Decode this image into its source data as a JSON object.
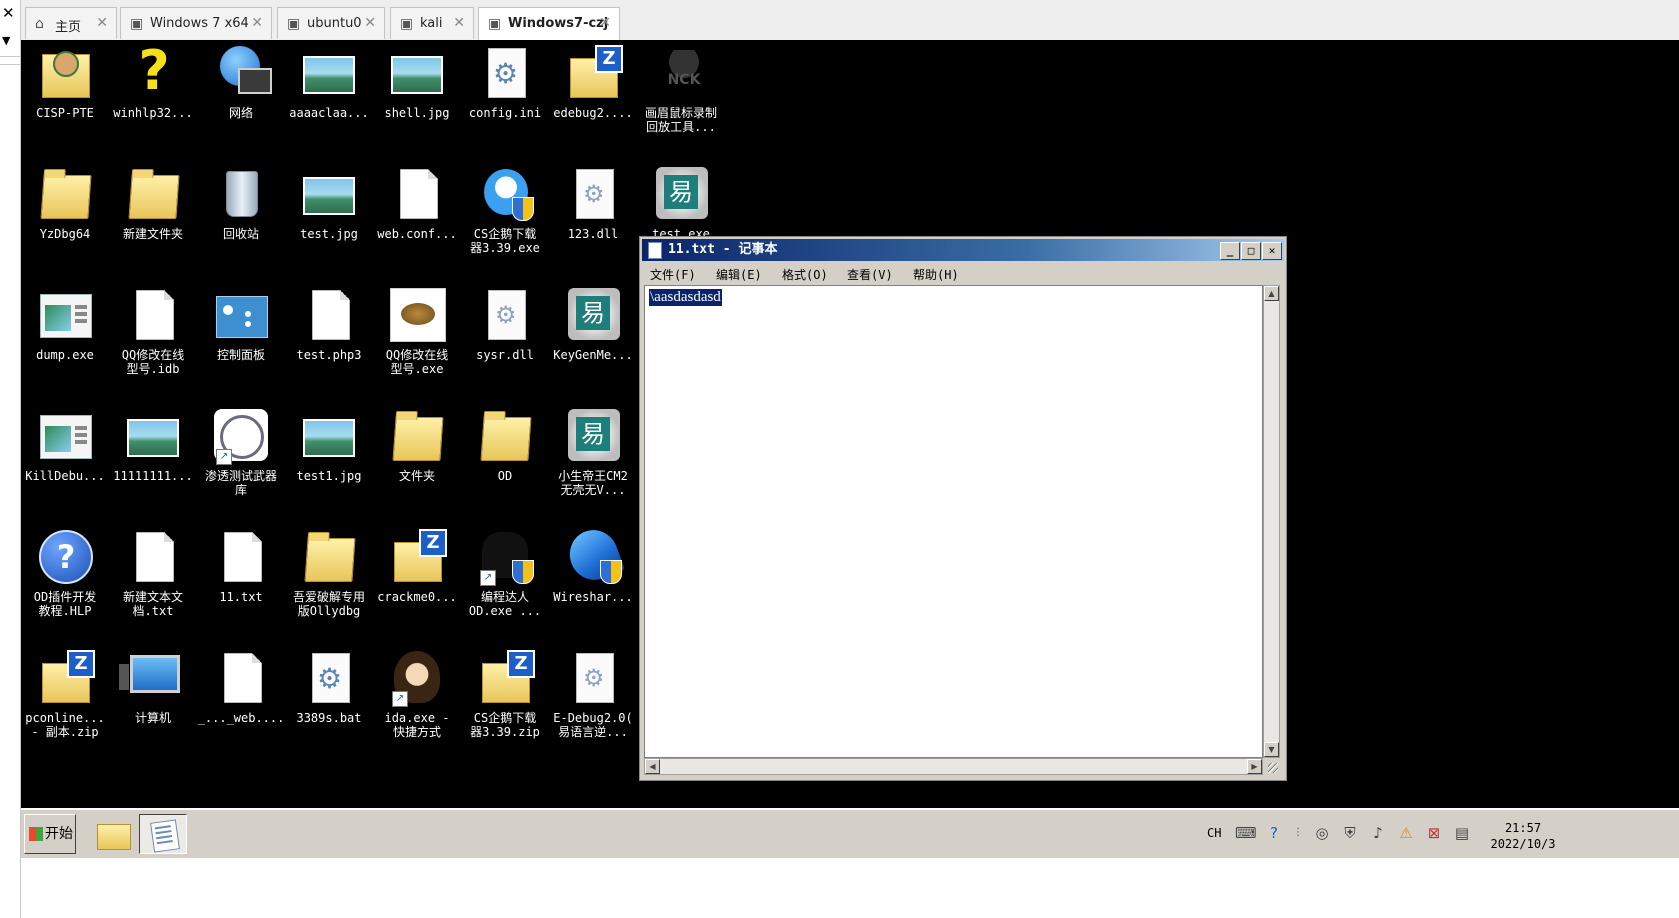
{
  "vm_tabs": [
    {
      "label": "主页",
      "icon": "home-icon"
    },
    {
      "label": "Windows 7 x64",
      "icon": "vm-icon"
    },
    {
      "label": "ubuntu0",
      "icon": "vm-icon"
    },
    {
      "label": "kali",
      "icon": "vm-icon"
    },
    {
      "label": "Windows7-czj",
      "icon": "vm-icon",
      "active": true
    }
  ],
  "desktop_icons": [
    {
      "label": "CISP-PTE",
      "icon": "user-folder-icon"
    },
    {
      "label": "winhlp32...",
      "icon": "help-question-icon"
    },
    {
      "label": "网络",
      "icon": "network-icon"
    },
    {
      "label": "aaaaclaa...",
      "icon": "image-file-icon"
    },
    {
      "label": "shell.jpg",
      "icon": "image-file-icon"
    },
    {
      "label": "config.ini",
      "icon": "config-file-icon"
    },
    {
      "label": "edebug2....",
      "icon": "zip-folder-icon"
    },
    {
      "label": "画眉鼠标录制\n回放工具...",
      "icon": "nck-app-icon"
    },
    {
      "label": "YzDbg64",
      "icon": "folder-icon"
    },
    {
      "label": "新建文件夹",
      "icon": "folder-icon"
    },
    {
      "label": "回收站",
      "icon": "recycle-bin-icon"
    },
    {
      "label": "test.jpg",
      "icon": "image-file-icon"
    },
    {
      "label": "web.conf...",
      "icon": "blank-file-icon"
    },
    {
      "label": "CS企鹅下载\n器3.39.exe",
      "icon": "penguin-app-icon"
    },
    {
      "label": "123.dll",
      "icon": "dll-file-icon"
    },
    {
      "label": "test.exe",
      "icon": "easy-language-exe-icon"
    },
    {
      "label": "dump.exe",
      "icon": "app-window-icon"
    },
    {
      "label": "QQ修改在线\n型号.idb",
      "icon": "blank-file-icon"
    },
    {
      "label": "控制面板",
      "icon": "control-panel-icon"
    },
    {
      "label": "test.php3",
      "icon": "blank-file-icon"
    },
    {
      "label": "QQ修改在线\n型号.exe",
      "icon": "turtle-app-icon"
    },
    {
      "label": "sysr.dll",
      "icon": "dll-file-icon"
    },
    {
      "label": "KeyGenMe...",
      "icon": "easy-language-exe-icon"
    },
    {
      "label": "KillDebu...",
      "icon": "app-window-icon"
    },
    {
      "label": "11111111...",
      "icon": "image-file-icon"
    },
    {
      "label": "渗透测试武器\n库",
      "icon": "circle-app-shortcut-icon"
    },
    {
      "label": "test1.jpg",
      "icon": "image-file-icon"
    },
    {
      "label": "文件夹",
      "icon": "folder-icon"
    },
    {
      "label": "OD",
      "icon": "folder-icon"
    },
    {
      "label": "小生帝王CM2\n无壳无V...",
      "icon": "easy-language-exe-icon"
    },
    {
      "label": "OD插件开发\n教程.HLP",
      "icon": "help-file-icon"
    },
    {
      "label": "新建文本文\n档.txt",
      "icon": "text-file-icon"
    },
    {
      "label": "11.txt",
      "icon": "text-file-icon"
    },
    {
      "label": "吾爱破解专用\n版Ollydbg",
      "icon": "folder-icon"
    },
    {
      "label": "crackme0...",
      "icon": "zip-folder-icon"
    },
    {
      "label": "编程达人\nOD.exe ...",
      "icon": "dark-app-shortcut-icon"
    },
    {
      "label": "Wireshar...",
      "icon": "wireshark-icon"
    },
    {
      "label": "pconline...\n- 副本.zip",
      "icon": "zip-folder-icon"
    },
    {
      "label": "计算机",
      "icon": "computer-icon"
    },
    {
      "label": "_..._web....",
      "icon": "blank-file-icon"
    },
    {
      "label": "3389s.bat",
      "icon": "bat-file-icon"
    },
    {
      "label": "ida.exe -\n快捷方式",
      "icon": "ida-shortcut-icon"
    },
    {
      "label": "CS企鹅下载\n器3.39.zip",
      "icon": "zip-folder-icon"
    },
    {
      "label": "E-Debug2.0(\n易语言逆...",
      "icon": "dll-file-icon"
    }
  ],
  "notepad": {
    "title": "11.txt - 记事本",
    "menu": [
      "文件(F)",
      "编辑(E)",
      "格式(O)",
      "查看(V)",
      "帮助(H)"
    ],
    "content": "\\aasdasdasd",
    "selection_color": "#0a246a"
  },
  "taskbar": {
    "start_label": "开始",
    "language": "CH",
    "time": "21:57",
    "date": "2022/10/3"
  },
  "colors": {
    "desktop": "#000000",
    "titlebar_start": "#0a246a",
    "titlebar_end": "#a6caf0",
    "chrome": "#d4d0c8"
  }
}
